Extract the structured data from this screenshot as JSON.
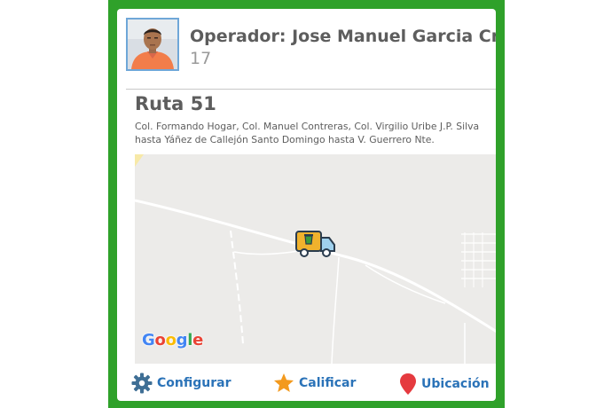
{
  "colors": {
    "frame": "#2fa12a",
    "accent_blue": "#2b73b8",
    "text_gray": "#5d5d5d",
    "star": "#f39a1e",
    "pin": "#e53a3f",
    "gear": "#3f6f95",
    "truck_body": "#f0b22d",
    "truck_cab": "#9fd1ee"
  },
  "operator": {
    "label": "Operador: Jose Manuel Garcia Cristiano",
    "number": "17",
    "avatar_icon": "operator-photo"
  },
  "route": {
    "title": "Ruta 51",
    "description": "Col. Formando Hogar, Col. Manuel Contreras, Col. Virgilio Uribe J.P. Silva hasta Yáñez de Callejón Santo Domingo hasta V. Guerrero Nte."
  },
  "map": {
    "provider_logo": "Google",
    "vehicle_icon": "garbage-truck-icon"
  },
  "footer": {
    "configure": {
      "label": "Configurar",
      "icon": "gear-icon"
    },
    "rate": {
      "label": "Calificar",
      "icon": "star-icon"
    },
    "location": {
      "label": "Ubicación",
      "icon": "location-pin-icon"
    }
  }
}
